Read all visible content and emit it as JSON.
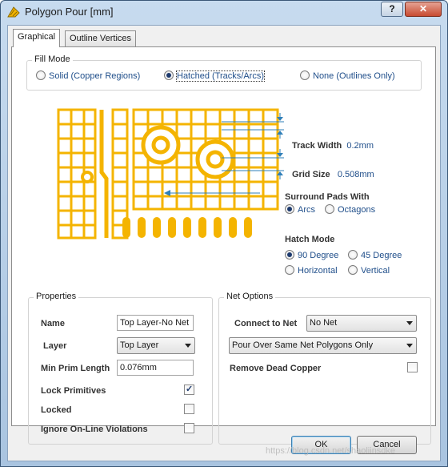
{
  "window": {
    "title": "Polygon Pour [mm]",
    "help_label": "?",
    "close_label": "✕"
  },
  "tabs": [
    {
      "label": "Graphical"
    },
    {
      "label": "Outline Vertices"
    }
  ],
  "fill_mode": {
    "label": "Fill Mode",
    "options": [
      {
        "label": "Solid (Copper Regions)",
        "selected": false
      },
      {
        "label": "Hatched (Tracks/Arcs)",
        "selected": true
      },
      {
        "label": "None (Outlines Only)",
        "selected": false
      }
    ]
  },
  "preview": {
    "track_width_label": "Track Width",
    "track_width_value": "0.2mm",
    "grid_size_label": "Grid Size",
    "grid_size_value": "0.508mm",
    "surround_label": "Surround Pads With",
    "surround_options": [
      {
        "label": "Arcs",
        "selected": true
      },
      {
        "label": "Octagons",
        "selected": false
      }
    ],
    "hatch_label": "Hatch Mode",
    "hatch_options": [
      {
        "label": "90 Degree",
        "selected": true
      },
      {
        "label": "45 Degree",
        "selected": false
      },
      {
        "label": "Horizontal",
        "selected": false
      },
      {
        "label": "Vertical",
        "selected": false
      }
    ],
    "copper_color": "#f4b400"
  },
  "properties": {
    "label": "Properties",
    "name_label": "Name",
    "name_value": "Top Layer-No Net",
    "layer_label": "Layer",
    "layer_value": "Top Layer",
    "min_prim_label": "Min Prim Length",
    "min_prim_value": "0.076mm",
    "lock_label": "Lock Primitives",
    "lock_checked": true,
    "locked_label": "Locked",
    "locked_checked": false,
    "ignore_label": "Ignore On-Line Violations",
    "ignore_checked": false
  },
  "net_options": {
    "label": "Net Options",
    "connect_label": "Connect to Net",
    "connect_value": "No Net",
    "pour_value": "Pour Over Same Net Polygons Only",
    "remove_label": "Remove Dead Copper",
    "remove_checked": false
  },
  "buttons": {
    "ok": "OK",
    "cancel": "Cancel"
  },
  "watermark": "https://blog.csdn.net/shaoliinsdke"
}
